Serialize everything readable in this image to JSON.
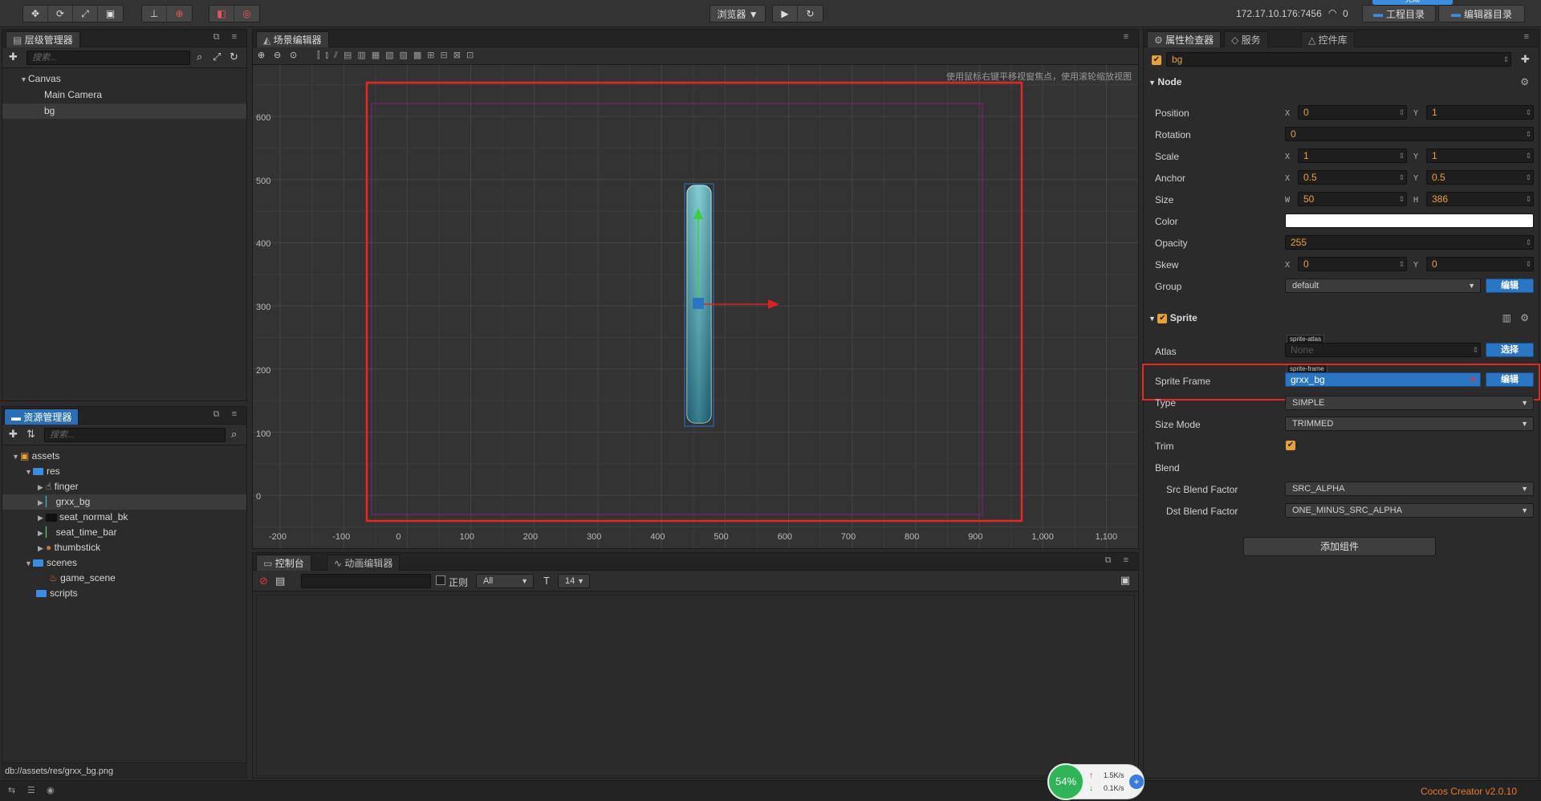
{
  "toolbar": {
    "transform_tools": [
      "move-tool",
      "rotate-tool",
      "scale-tool",
      "rect-tool"
    ],
    "pivot_tools": [
      "pivot-toggle",
      "anchor-toggle"
    ],
    "coord_tools": [
      "local-coords",
      "global-coords"
    ],
    "preview_label": "浏览器 ▼",
    "play_glyph": "▶",
    "refresh_glyph": "↻",
    "ip_address": "172.17.10.176:7456",
    "wifi_count": "0",
    "project_dir_label": "工程目录",
    "editor_dir_label": "编辑器目录",
    "popup_label": "完成"
  },
  "hierarchy": {
    "tab_label": "层级管理器",
    "search_placeholder": "搜索...",
    "items": [
      {
        "label": "Canvas"
      },
      {
        "label": "Main Camera"
      },
      {
        "label": "bg"
      }
    ]
  },
  "assets": {
    "tab_label": "资源管理器",
    "search_placeholder": "搜索...",
    "items": [
      {
        "label": "assets"
      },
      {
        "label": "res"
      },
      {
        "label": "finger"
      },
      {
        "label": "grxx_bg"
      },
      {
        "label": "seat_normal_bk"
      },
      {
        "label": "seat_time_bar"
      },
      {
        "label": "thumbstick"
      },
      {
        "label": "scenes"
      },
      {
        "label": "game_scene"
      },
      {
        "label": "scripts"
      }
    ],
    "status_path": "db://assets/res/grxx_bg.png"
  },
  "scene": {
    "tab_label": "场景编辑器",
    "hint": "使用鼠标右键平移视窗焦点，使用滚轮缩放视图",
    "y_ticks": [
      "600",
      "500",
      "400",
      "300",
      "200",
      "100",
      "0"
    ],
    "x_ticks": [
      "-200",
      "-100",
      "0",
      "100",
      "200",
      "300",
      "400",
      "500",
      "600",
      "700",
      "800",
      "900",
      "1,000",
      "1,100"
    ]
  },
  "console": {
    "tab_console": "控制台",
    "tab_animation": "动画编辑器",
    "regex_label": "正则",
    "filter_value": "All",
    "font_size_value": "14"
  },
  "inspector": {
    "tab_props": "属性检查器",
    "tab_services": "服务",
    "tab_library": "控件库",
    "node_name": "bg",
    "node_section": "Node",
    "position_label": "Position",
    "position_x": "0",
    "position_y": "1",
    "rotation_label": "Rotation",
    "rotation": "0",
    "scale_label": "Scale",
    "scale_x": "1",
    "scale_y": "1",
    "anchor_label": "Anchor",
    "anchor_x": "0.5",
    "anchor_y": "0.5",
    "size_label": "Size",
    "size_w": "50",
    "size_h": "386",
    "color_label": "Color",
    "color_value": "#ffffff",
    "opacity_label": "Opacity",
    "opacity": "255",
    "skew_label": "Skew",
    "skew_x": "0",
    "skew_y": "0",
    "group_label": "Group",
    "group_value": "default",
    "edit_label": "编辑",
    "sprite_section": "Sprite",
    "atlas_label": "Atlas",
    "atlas_tag": "sprite-atlas",
    "atlas_value": "None",
    "choose_label": "选择",
    "sprite_frame_label": "Sprite Frame",
    "sprite_frame_tag": "sprite-frame",
    "sprite_frame_value": "grxx_bg",
    "type_label": "Type",
    "type_value": "SIMPLE",
    "size_mode_label": "Size Mode",
    "size_mode_value": "TRIMMED",
    "trim_label": "Trim",
    "blend_label": "Blend",
    "src_blend_label": "Src Blend Factor",
    "src_blend_value": "SRC_ALPHA",
    "dst_blend_label": "Dst Blend Factor",
    "dst_blend_value": "ONE_MINUS_SRC_ALPHA",
    "add_component_label": "添加组件",
    "axis_x": "X",
    "axis_y": "Y",
    "axis_w": "W",
    "axis_h": "H"
  },
  "footer": {
    "version": "Cocos Creator v2.0.10",
    "net_percent": "54%",
    "upload_speed": "1.5K/s",
    "download_speed": "0.1K/s"
  },
  "colors": {
    "highlight_red": "#e8281e",
    "accent_orange": "#e8a13a",
    "selection_blue": "#2a76c5"
  }
}
